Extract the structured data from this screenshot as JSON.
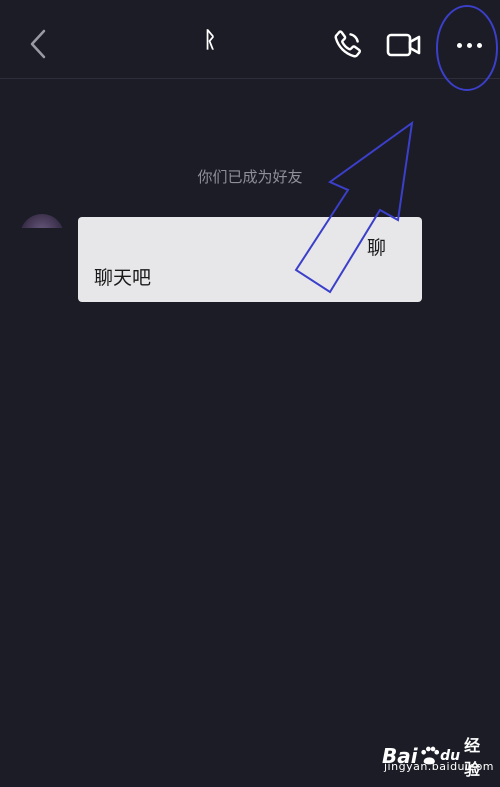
{
  "header": {
    "title": "ᚱ",
    "back_icon": "chevron-left-icon",
    "call_icon": "phone-icon",
    "video_icon": "video-camera-icon",
    "more_icon": "more-dots-icon"
  },
  "chat": {
    "system_message": "你们已成为好友",
    "messages": [
      {
        "sender": "contact",
        "line1": "聊",
        "line2": "聊天吧"
      }
    ]
  },
  "watermark": {
    "logo_text": "Bai",
    "logo_text_tail": "du",
    "logo_suffix": "经验",
    "url": "jingyan.baidu.com"
  },
  "colors": {
    "background": "#1b1c26",
    "bubble": "#e7e7e9",
    "annotation": "#3b3fc9",
    "system_text": "#8e8f99"
  }
}
